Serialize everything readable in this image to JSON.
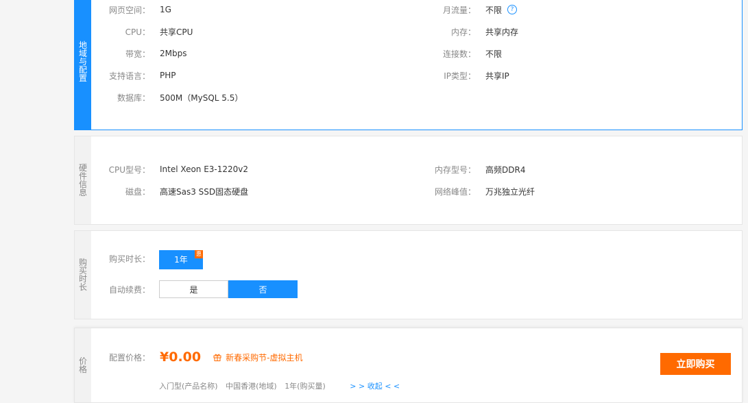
{
  "config": {
    "side": "地域与配置",
    "left": [
      {
        "label": "网页空间：",
        "value": "1G"
      },
      {
        "label": "CPU：",
        "value": "共享CPU"
      },
      {
        "label": "带宽：",
        "value": "2Mbps"
      },
      {
        "label": "支持语言：",
        "value": "PHP"
      },
      {
        "label": "数据库：",
        "value": "500M（MySQL 5.5）"
      }
    ],
    "right": [
      {
        "label": "月流量：",
        "value": "不限"
      },
      {
        "label": "内存：",
        "value": "共享内存"
      },
      {
        "label": "连接数：",
        "value": "不限"
      },
      {
        "label": "IP类型：",
        "value": "共享IP"
      }
    ],
    "help": "?"
  },
  "hardware": {
    "side": "硬件信息",
    "left": [
      {
        "label": "CPU型号：",
        "value": "Intel Xeon E3-1220v2"
      },
      {
        "label": "磁盘：",
        "value": "高速Sas3 SSD固态硬盘"
      }
    ],
    "right": [
      {
        "label": "内存型号：",
        "value": "高频DDR4"
      },
      {
        "label": "网络峰值：",
        "value": "万兆独立光纤"
      }
    ]
  },
  "duration": {
    "side": "购买时长",
    "period_label": "购买时长：",
    "period_value": "1年",
    "period_badge": "惠",
    "renew_label": "自动续费：",
    "renew_yes": "是",
    "renew_no": "否"
  },
  "price": {
    "side": "价格",
    "label": "配置价格：",
    "amount": "¥0.00",
    "promo": "新春采购节-虚拟主机",
    "buy": "立即购买",
    "summary": [
      "入门型(产品名称)",
      "中国香港(地域)",
      "1年(购买量)"
    ],
    "collapse": "> > 收起 < <"
  },
  "colors": {
    "accent": "#1890ff",
    "orange": "#ff6a00"
  }
}
